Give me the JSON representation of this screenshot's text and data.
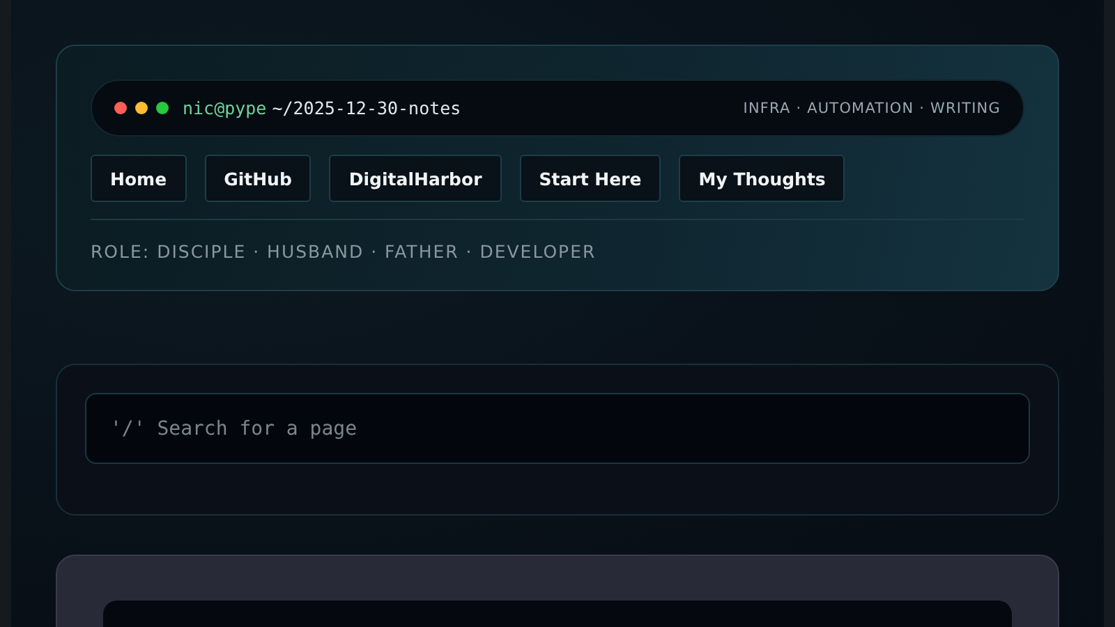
{
  "terminal": {
    "user": "nic@pype",
    "path": "~/2025-12-30-notes",
    "tags": "INFRA · AUTOMATION · WRITING"
  },
  "nav": [
    "Home",
    "GitHub",
    "DigitalHarbor",
    "Start Here",
    "My Thoughts"
  ],
  "role": "ROLE: DISCIPLE · HUSBAND · FATHER · DEVELOPER",
  "search": {
    "placeholder": "'/' Search for a page"
  }
}
